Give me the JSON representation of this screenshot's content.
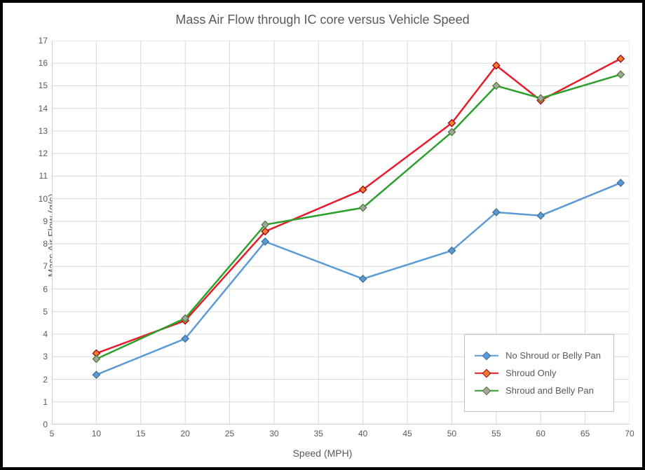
{
  "chart_data": {
    "type": "line",
    "title": "Mass Air Flow through IC core versus Vehicle Speed",
    "xlabel": "Speed (MPH)",
    "ylabel": "Mass Air Flow (g/s)",
    "xlim": [
      5,
      70
    ],
    "ylim": [
      0,
      17
    ],
    "xticks": [
      5,
      10,
      15,
      20,
      25,
      30,
      35,
      40,
      45,
      50,
      55,
      60,
      65,
      70
    ],
    "yticks": [
      0,
      1,
      2,
      3,
      4,
      5,
      6,
      7,
      8,
      9,
      10,
      11,
      12,
      13,
      14,
      15,
      16,
      17
    ],
    "x": [
      10,
      20,
      29,
      40,
      50,
      55,
      60,
      69
    ],
    "series": [
      {
        "name": "No Shroud or Belly Pan",
        "values": [
          2.2,
          3.8,
          8.1,
          6.45,
          7.7,
          9.4,
          9.25,
          10.7
        ],
        "line_color": "#5B9BD5",
        "marker_border": "#41719C",
        "marker_fill": "#5B9BD5"
      },
      {
        "name": "Shroud Only",
        "values": [
          3.15,
          4.6,
          8.55,
          10.4,
          13.35,
          15.9,
          14.35,
          16.2
        ],
        "line_color": "#E61C2A",
        "marker_border": "#A5000E",
        "marker_fill": "#ED7D31"
      },
      {
        "name": "Shroud and Belly Pan",
        "values": [
          2.9,
          4.7,
          8.85,
          9.6,
          12.95,
          15.0,
          14.45,
          15.5
        ],
        "line_color": "#2CA02C",
        "marker_border": "#507E32",
        "marker_fill": "#A5A5A5"
      }
    ],
    "legend_position": "bottom-right",
    "grid": true
  }
}
